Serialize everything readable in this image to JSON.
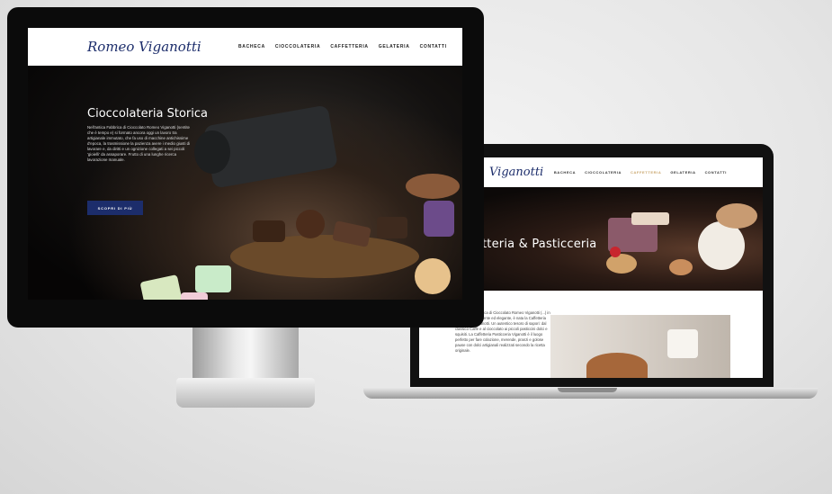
{
  "monitor": {
    "logo": "Romeo Viganotti",
    "nav": [
      "BACHECA",
      "CIOCCOLATERIA",
      "CAFFETTERIA",
      "GELATERIA",
      "CONTATTI"
    ],
    "hero": {
      "title": "Cioccolateria Storica",
      "body": "Nell'antica Fabbrica di Cioccolato Romeo Viganotti (sentite che è tempo e) si formato ancora oggi un lavoro tra artigianale immutato, che fa uso di macchine antichissime d'epoca, la trasmissione la pazienza avere i medio giusti di lavorare e, da diritti e un ognizione collegati a sei piccoli 'gioielli' da assaporare. Frutto di una lunghe ricerca lavorazione manuale.",
      "button": "SCOPRI DI PIÙ"
    }
  },
  "laptop": {
    "logo": "Viganotti",
    "nav": [
      "BACHECA",
      "CIOCCOLATERIA",
      "CAFFETTERIA",
      "GELATERIA",
      "CONTATTI"
    ],
    "hero_title": "tteria & Pasticceria",
    "content_text": "Nell'antica Fabbrica di Cioccolato Romeo Viganotti (...) in un locale accogliente ed elegante, è nata la Caffetteria Pasticceria Viganotti. Un autentico tesoro di sapori: dal classico Caffè e al cioccolato ai piccoli pasticcini dolci e squisiti. La Caffetteria Pasticceria Viganotti è il luogo perfetto per fare colazione, merende, pranzi e golose pause con dolci artigianali realizzati secondo la ricetta originale."
  },
  "colors": {
    "brand_navy": "#1c2d6b",
    "active_gold": "#c9a46a"
  }
}
